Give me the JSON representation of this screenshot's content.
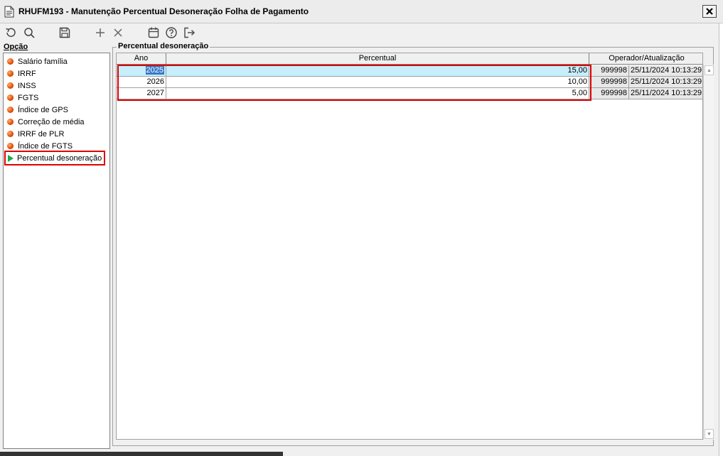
{
  "window": {
    "title": "RHUFM193 - Manutenção Percentual Desoneração Folha de Pagamento",
    "close_label": "X"
  },
  "toolbar": {
    "buttons": [
      {
        "icon": "undo-icon"
      },
      {
        "icon": "search-icon"
      },
      {
        "icon": "save-icon"
      },
      {
        "icon": "add-icon"
      },
      {
        "icon": "delete-icon"
      },
      {
        "icon": "calendar-icon"
      },
      {
        "icon": "help-icon"
      },
      {
        "icon": "exit-icon"
      }
    ]
  },
  "options": {
    "label": "Opção",
    "items": [
      {
        "label": "Salário família"
      },
      {
        "label": "IRRF"
      },
      {
        "label": "INSS"
      },
      {
        "label": "FGTS"
      },
      {
        "label": "Índice de GPS"
      },
      {
        "label": "Correção de média"
      },
      {
        "label": "IRRF de PLR"
      },
      {
        "label": "Índice de FGTS"
      },
      {
        "label": "Percentual desoneração",
        "selected": true
      }
    ]
  },
  "group": {
    "title": "Percentual desoneração",
    "columns": {
      "ano": "Ano",
      "percentual": "Percentual",
      "operador": "Operador/Atualização"
    },
    "rows": [
      {
        "ano": "2025",
        "percentual": "15,00",
        "operador": "999998",
        "atualizacao": "25/11/2024 10:13:29"
      },
      {
        "ano": "2026",
        "percentual": "10,00",
        "operador": "999998",
        "atualizacao": "25/11/2024 10:13:29"
      },
      {
        "ano": "2027",
        "percentual": "5,00",
        "operador": "999998",
        "atualizacao": "25/11/2024 10:13:29"
      }
    ]
  },
  "colors": {
    "highlight_row": "#c6eefb",
    "annotation_red": "#e00000",
    "bullet_orange": "#e24a00",
    "selected_arrow_green": "#19a84a"
  }
}
